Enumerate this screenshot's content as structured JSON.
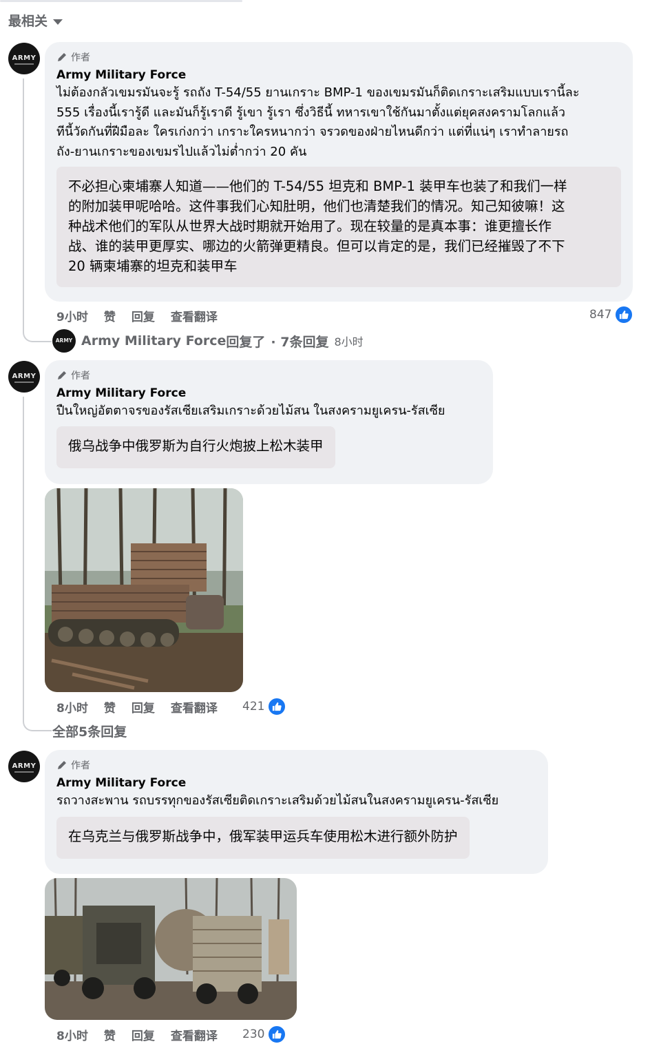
{
  "sort": {
    "label": "最相关"
  },
  "comments": [
    {
      "avatar_text": "ARMY",
      "badge": "作者",
      "author": "Army Military Force",
      "text_lines": [
        "ไม่ต้องกลัวเขมรมันจะรู้ รถถัง T-54/55 ยานเกราะ BMP-1 ของเขมรมันก็ติดเกราะเสริมแบบเรานี้ละ",
        "555 เรื่องนี้เรารู้ดี และมันก็รู้เราดี รู้เขา รู้เรา ซึ่งวิธีนี้ ทหารเขาใช้กันมาตั้งแต่ยุคสงครามโลกแล้ว",
        "ทีนี้วัดกันที่ฝีมือละ ใครเก่งกว่า เกราะใครหนากว่า จรวดของฝ่ายไหนดีกว่า แต่ที่แน่ๆ เราทำลายรถ",
        "ถัง-ยานเกราะของเขมรไปแล้วไม่ต่ำกว่า 20 คัน"
      ],
      "translation_lines": [
        "不必担心柬埔寨人知道——他们的 T-54/55 坦克和 BMP-1 装甲车也装了和我们一样",
        "的附加装甲呢哈哈。这件事我们心知肚明，他们也清楚我们的情况。知己知彼嘛！这",
        "种战术他们的军队从世界大战时期就开始用了。现在较量的是真本事：谁更擅长作",
        "战、谁的装甲更厚实、哪边的火箭弹更精良。但可以肯定的是，我们已经摧毁了不下",
        "20 辆柬埔寨的坦克和装甲车"
      ],
      "time": "9小时",
      "like": "赞",
      "reply": "回复",
      "translate": "查看翻译",
      "reactions": "847",
      "replies_row": {
        "name": "Army Military Force",
        "action": "回复了",
        "count": "· 7条回复",
        "time": "8小时"
      }
    },
    {
      "avatar_text": "ARMY",
      "badge": "作者",
      "author": "Army Military Force",
      "text_lines": [
        "ปืนใหญ่อัตตาจรของรัสเซียเสริมเกราะด้วยไม้สน ในสงครามยูเครน-รัสเซีย"
      ],
      "translation_lines": [
        "俄乌战争中俄罗斯为自行火炮披上松木装甲"
      ],
      "time": "8小时",
      "like": "赞",
      "reply": "回复",
      "translate": "查看翻译",
      "reactions": "421",
      "more_replies": "全部5条回复"
    },
    {
      "avatar_text": "ARMY",
      "badge": "作者",
      "author": "Army Military Force",
      "text_lines": [
        "รถวางสะพาน รถบรรทุกของรัสเซียติดเกราะเสริมด้วยไม้สนในสงครามยูเครน-รัสเซีย"
      ],
      "translation_lines": [
        "在乌克兰与俄罗斯战争中，俄军装甲运兵车使用松木进行额外防护"
      ],
      "time": "8小时",
      "like": "赞",
      "reply": "回复",
      "translate": "查看翻译",
      "reactions": "230"
    }
  ]
}
